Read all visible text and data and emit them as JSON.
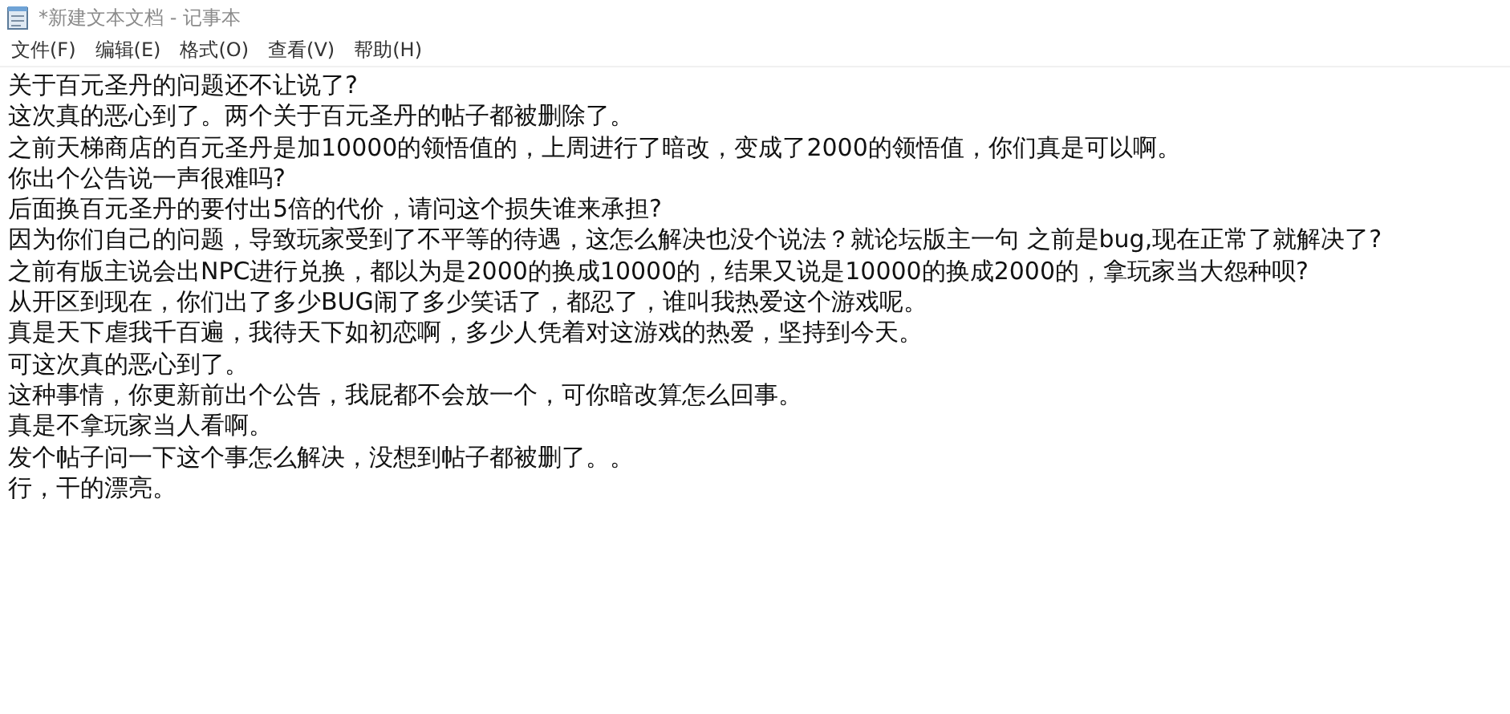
{
  "window": {
    "title": "*新建文本文档 - 记事本"
  },
  "menu": [
    "文件(F)",
    "编辑(E)",
    "格式(O)",
    "查看(V)",
    "帮助(H)"
  ],
  "document": {
    "lines": [
      "关于百元圣丹的问题还不让说了?",
      "这次真的恶心到了。两个关于百元圣丹的帖子都被删除了。",
      "之前天梯商店的百元圣丹是加10000的领悟值的，上周进行了暗改，变成了2000的领悟值，你们真是可以啊。",
      "你出个公告说一声很难吗?",
      "后面换百元圣丹的要付出5倍的代价，请问这个损失谁来承担?",
      "因为你们自己的问题，导致玩家受到了不平等的待遇，这怎么解决也没个说法？就论坛版主一句 之前是bug,现在正常了就解决了?",
      "之前有版主说会出NPC进行兑换，都以为是2000的换成10000的，结果又说是10000的换成2000的，拿玩家当大怨种呗?",
      "从开区到现在，你们出了多少BUG闹了多少笑话了，都忍了，谁叫我热爱这个游戏呢。",
      "真是天下虐我千百遍，我待天下如初恋啊，多少人凭着对这游戏的热爱，坚持到今天。",
      "可这次真的恶心到了。",
      "这种事情，你更新前出个公告，我屁都不会放一个，可你暗改算怎么回事。",
      "真是不拿玩家当人看啊。",
      "发个帖子问一下这个事怎么解决，没想到帖子都被删了。。",
      "行，干的漂亮。"
    ]
  }
}
